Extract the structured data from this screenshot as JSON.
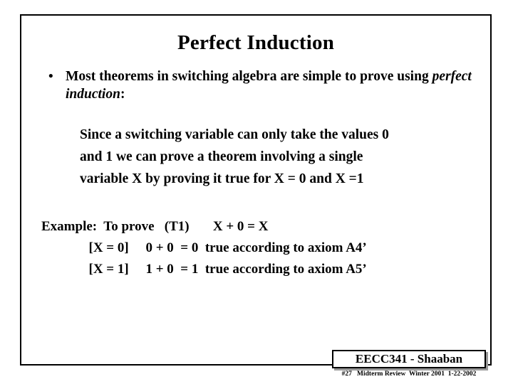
{
  "slide": {
    "title": "Perfect Induction",
    "bullet": {
      "marker": "•",
      "text_before_italic": "Most theorems in switching algebra are simple to prove using ",
      "italic_text": "perfect induction",
      "text_after_italic": ":"
    },
    "quote_lines": [
      "Since a switching variable can only take the values 0",
      "and 1 we can prove a theorem involving a single",
      "variable X by proving it true for X = 0 and X =1"
    ],
    "example": {
      "line1": "Example:  To prove   (T1)       X + 0 = X",
      "line2": "              [X = 0]     0 + 0  = 0  true according to axiom A4’",
      "line3": "              [X = 1]     1 + 0  = 1  true according to axiom A5’"
    },
    "footer": {
      "course": "EECC341 - Shaaban",
      "note": "#27   Midterm Review  Winter 2001  1-22-2002"
    }
  }
}
